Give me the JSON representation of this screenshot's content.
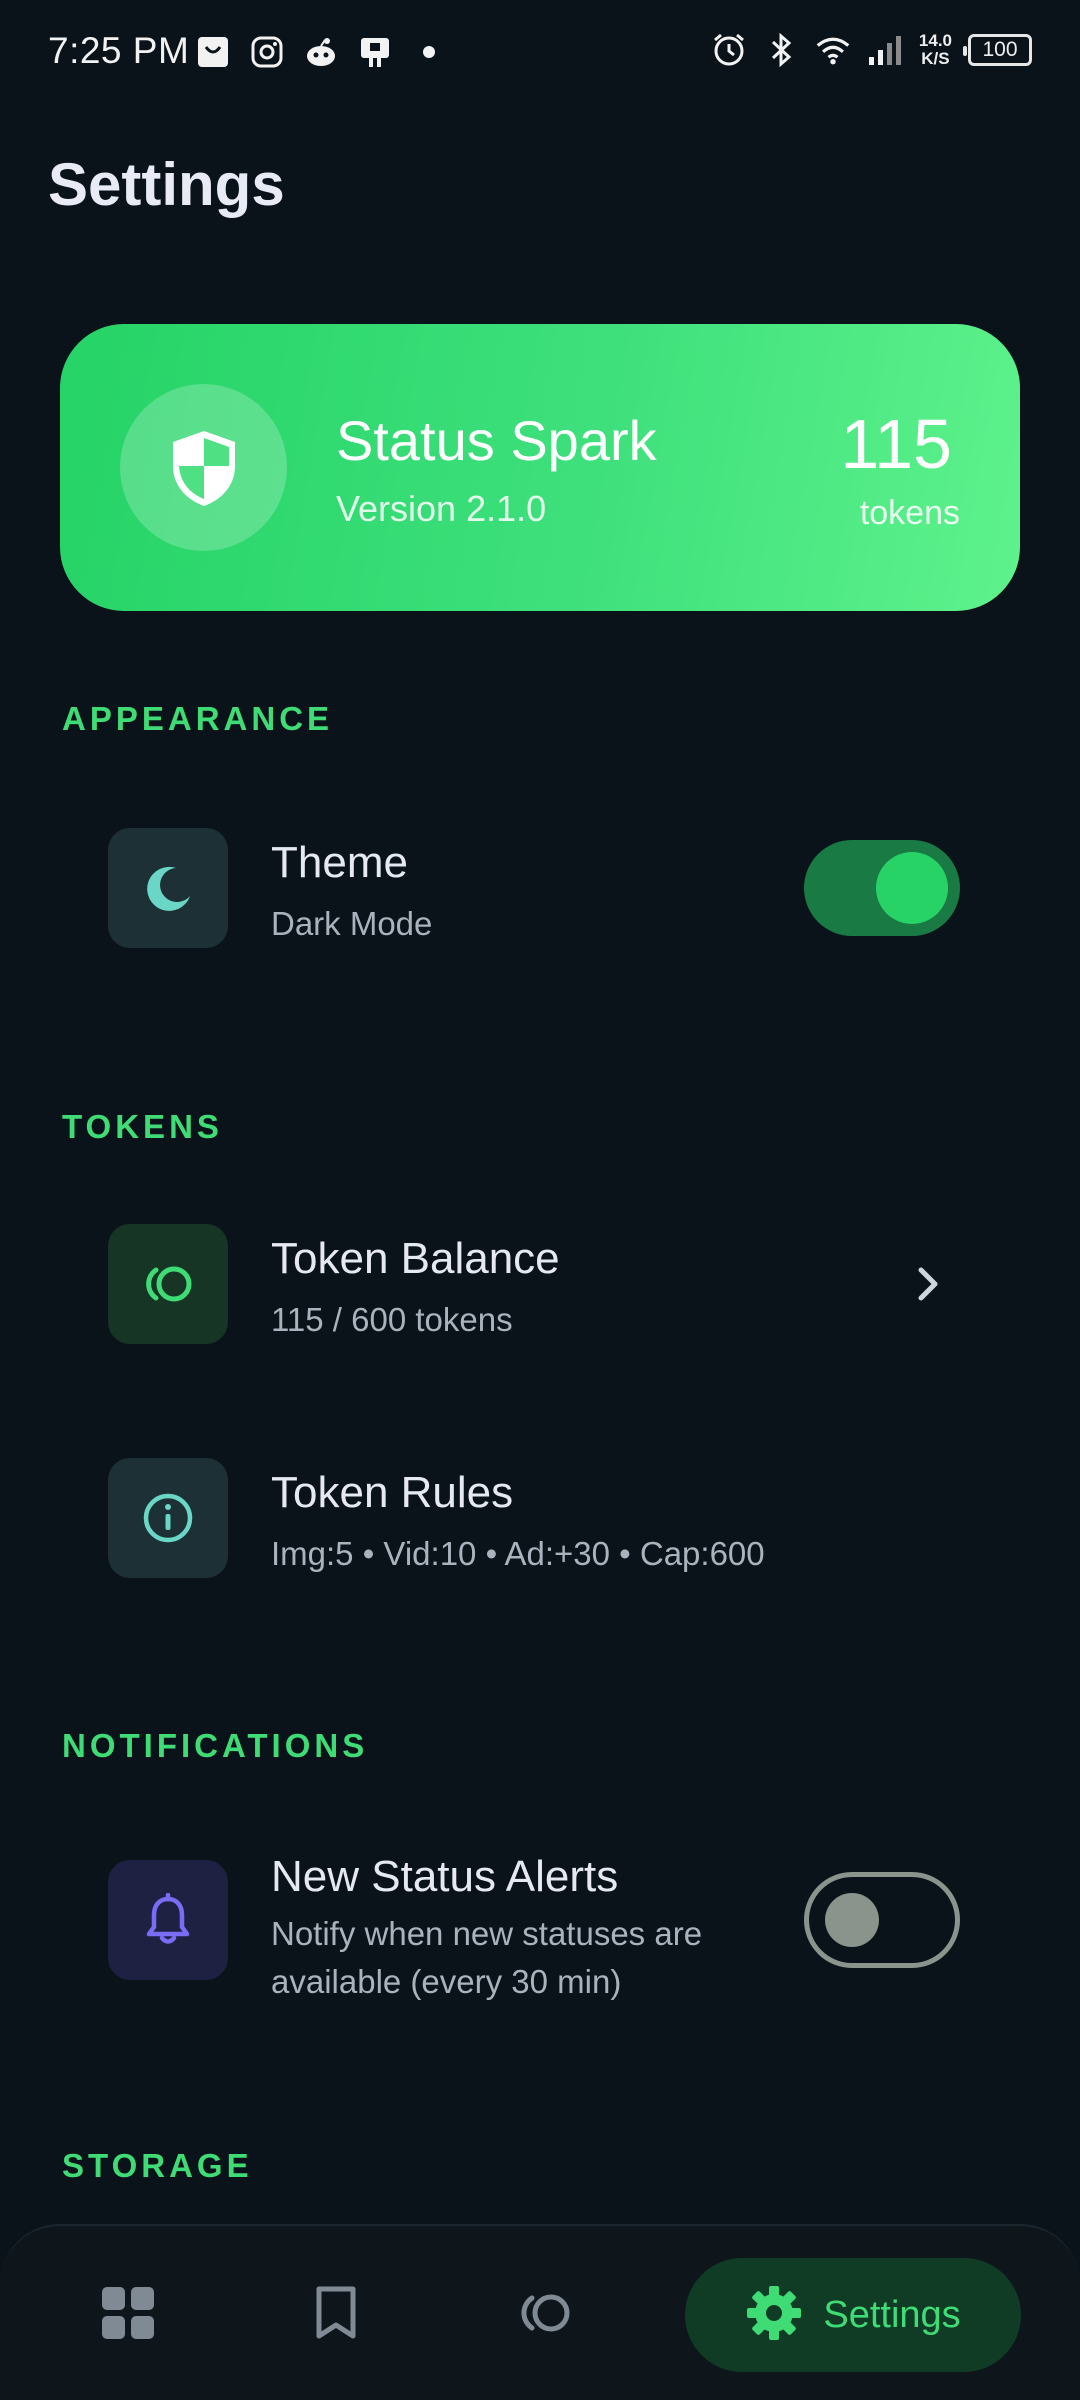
{
  "status_bar": {
    "time": "7:25 PM",
    "net_speed_value": "14.0",
    "net_speed_unit": "K/S",
    "battery": "100",
    "left_icons": [
      "shopping-bag-icon",
      "instagram-icon",
      "reddit-icon",
      "cast-icon",
      "dot-icon"
    ],
    "right_icons": [
      "alarm-icon",
      "bluetooth-icon",
      "wifi-icon",
      "signal-icon"
    ]
  },
  "page": {
    "title": "Settings"
  },
  "hero": {
    "app_name": "Status Spark",
    "version": "Version 2.1.0",
    "token_count": "115",
    "token_label": "tokens",
    "icon": "shield-icon"
  },
  "sections": {
    "appearance": {
      "header": "APPEARANCE",
      "theme": {
        "title": "Theme",
        "subtitle": "Dark Mode",
        "icon": "moon-icon",
        "enabled": true
      }
    },
    "tokens": {
      "header": "TOKENS",
      "balance": {
        "title": "Token Balance",
        "subtitle": "115 / 600 tokens",
        "icon": "token-icon"
      },
      "rules": {
        "title": "Token Rules",
        "subtitle": "Img:5 • Vid:10 • Ad:+30 • Cap:600",
        "icon": "info-icon"
      }
    },
    "notifications": {
      "header": "NOTIFICATIONS",
      "alerts": {
        "title": "New Status Alerts",
        "subtitle_line1": "Notify when new statuses are",
        "subtitle_line2": "available (every 30 min)",
        "icon": "bell-icon",
        "enabled": false
      }
    },
    "storage": {
      "header": "STORAGE"
    }
  },
  "bottom_nav": {
    "items": [
      {
        "icon": "grid-icon",
        "label": ""
      },
      {
        "icon": "bookmark-icon",
        "label": ""
      },
      {
        "icon": "token-icon",
        "label": ""
      },
      {
        "icon": "gear-icon",
        "label": "Settings",
        "active": true
      }
    ]
  },
  "colors": {
    "background": "#0b131a",
    "accent": "#3fdc76",
    "hero_gradient_start": "#25d366",
    "hero_gradient_end": "#5ef28c"
  }
}
